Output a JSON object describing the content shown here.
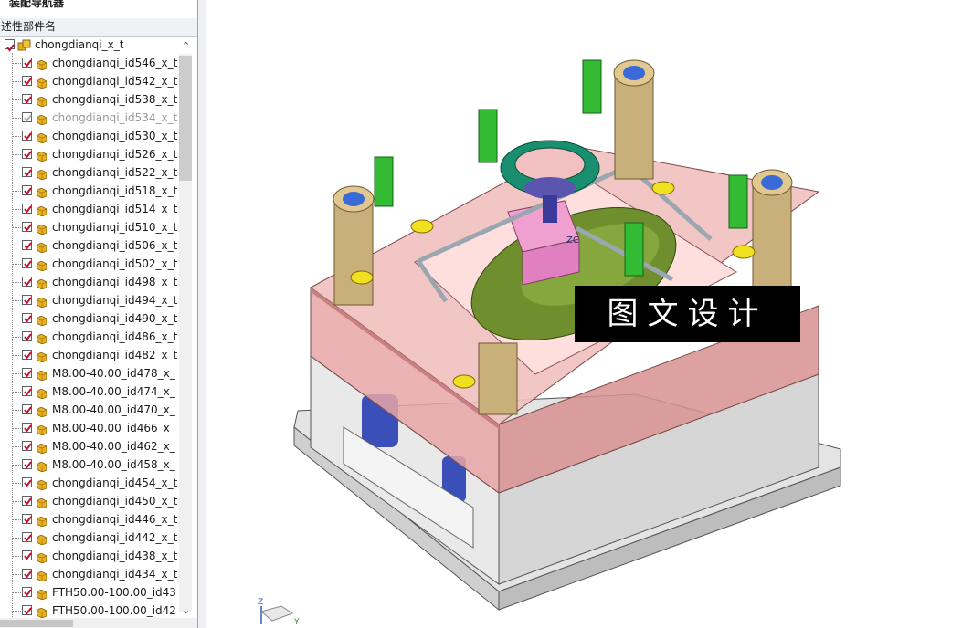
{
  "nav": {
    "title": "装配导航器",
    "column_header": "述性部件名",
    "root": {
      "label": "chongdianqi_x_t",
      "checked": true
    },
    "items": [
      {
        "label": "chongdianqi_id546_x_t",
        "checked": true
      },
      {
        "label": "chongdianqi_id542_x_t",
        "checked": true
      },
      {
        "label": "chongdianqi_id538_x_t",
        "checked": true
      },
      {
        "label": "chongdianqi_id534_x_t",
        "checked": false
      },
      {
        "label": "chongdianqi_id530_x_t",
        "checked": true
      },
      {
        "label": "chongdianqi_id526_x_t",
        "checked": true
      },
      {
        "label": "chongdianqi_id522_x_t",
        "checked": true
      },
      {
        "label": "chongdianqi_id518_x_t",
        "checked": true
      },
      {
        "label": "chongdianqi_id514_x_t",
        "checked": true
      },
      {
        "label": "chongdianqi_id510_x_t",
        "checked": true
      },
      {
        "label": "chongdianqi_id506_x_t",
        "checked": true
      },
      {
        "label": "chongdianqi_id502_x_t",
        "checked": true
      },
      {
        "label": "chongdianqi_id498_x_t",
        "checked": true
      },
      {
        "label": "chongdianqi_id494_x_t",
        "checked": true
      },
      {
        "label": "chongdianqi_id490_x_t",
        "checked": true
      },
      {
        "label": "chongdianqi_id486_x_t",
        "checked": true
      },
      {
        "label": "chongdianqi_id482_x_t",
        "checked": true
      },
      {
        "label": "M8.00-40.00_id478_x_",
        "checked": true
      },
      {
        "label": "M8.00-40.00_id474_x_",
        "checked": true
      },
      {
        "label": "M8.00-40.00_id470_x_",
        "checked": true
      },
      {
        "label": "M8.00-40.00_id466_x_",
        "checked": true
      },
      {
        "label": "M8.00-40.00_id462_x_",
        "checked": true
      },
      {
        "label": "M8.00-40.00_id458_x_",
        "checked": true
      },
      {
        "label": "chongdianqi_id454_x_t",
        "checked": true
      },
      {
        "label": "chongdianqi_id450_x_t",
        "checked": true
      },
      {
        "label": "chongdianqi_id446_x_t",
        "checked": true
      },
      {
        "label": "chongdianqi_id442_x_t",
        "checked": true
      },
      {
        "label": "chongdianqi_id438_x_t",
        "checked": true
      },
      {
        "label": "chongdianqi_id434_x_t",
        "checked": true
      },
      {
        "label": "FTH50.00-100.00_id43",
        "checked": true
      },
      {
        "label": "FTH50.00-100.00_id42",
        "checked": true
      }
    ]
  },
  "viewport": {
    "watermark": "图文设计",
    "axis": {
      "z": "Z",
      "y": "Y"
    },
    "label_zc": "ZC"
  },
  "colors": {
    "check_red": "#c8102e",
    "part_yellow": "#e8b020",
    "plate_pink": "#e8a0a0",
    "plate_gray": "#d8d8d8",
    "guide_tan": "#c9b07a",
    "bolt_green": "#33bb33",
    "spring_blue": "#3a4fb8",
    "cavity_green": "#6f8f2e"
  }
}
